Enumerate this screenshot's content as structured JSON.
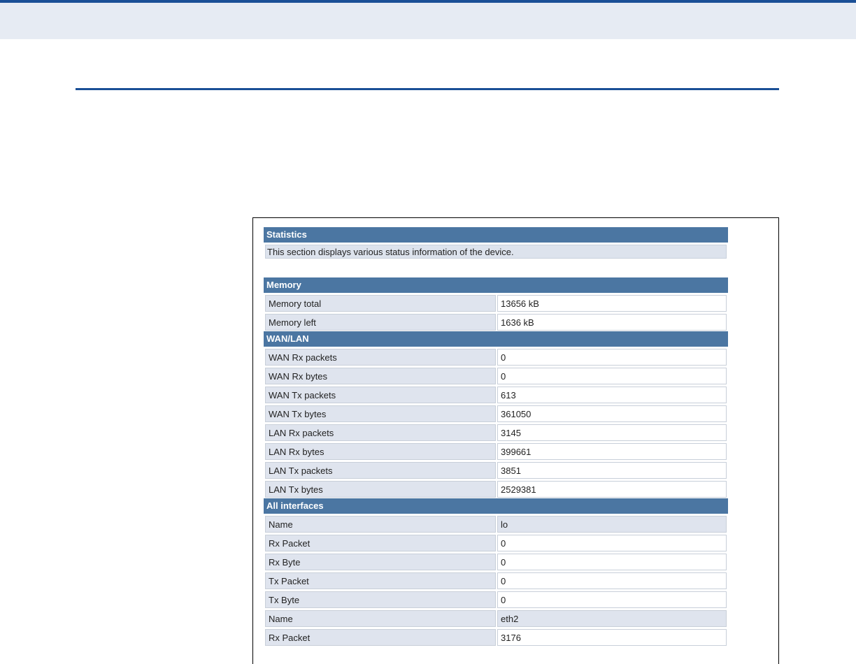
{
  "statistics": {
    "title": "Statistics",
    "description": "This section displays various status information of the device."
  },
  "memory": {
    "title": "Memory",
    "rows": [
      {
        "label": "Memory total",
        "value": "13656 kB"
      },
      {
        "label": "Memory left",
        "value": "1636 kB"
      }
    ]
  },
  "wanlan": {
    "title": "WAN/LAN",
    "rows": [
      {
        "label": "WAN Rx packets",
        "value": "0"
      },
      {
        "label": "WAN Rx bytes",
        "value": "0"
      },
      {
        "label": "WAN Tx packets",
        "value": "613"
      },
      {
        "label": "WAN Tx bytes",
        "value": "361050"
      },
      {
        "label": "LAN Rx packets",
        "value": "3145"
      },
      {
        "label": "LAN Rx bytes",
        "value": "399661"
      },
      {
        "label": "LAN Tx packets",
        "value": "3851"
      },
      {
        "label": "LAN Tx bytes",
        "value": "2529381"
      }
    ]
  },
  "interfaces": {
    "title": "All interfaces",
    "rows": [
      {
        "label": "Name",
        "value": "lo"
      },
      {
        "label": "Rx Packet",
        "value": "0"
      },
      {
        "label": "Rx Byte",
        "value": "0"
      },
      {
        "label": "Tx Packet",
        "value": "0"
      },
      {
        "label": "Tx Byte",
        "value": "0"
      },
      {
        "label": "Name",
        "value": "eth2"
      },
      {
        "label": "Rx Packet",
        "value": "3176"
      }
    ]
  }
}
